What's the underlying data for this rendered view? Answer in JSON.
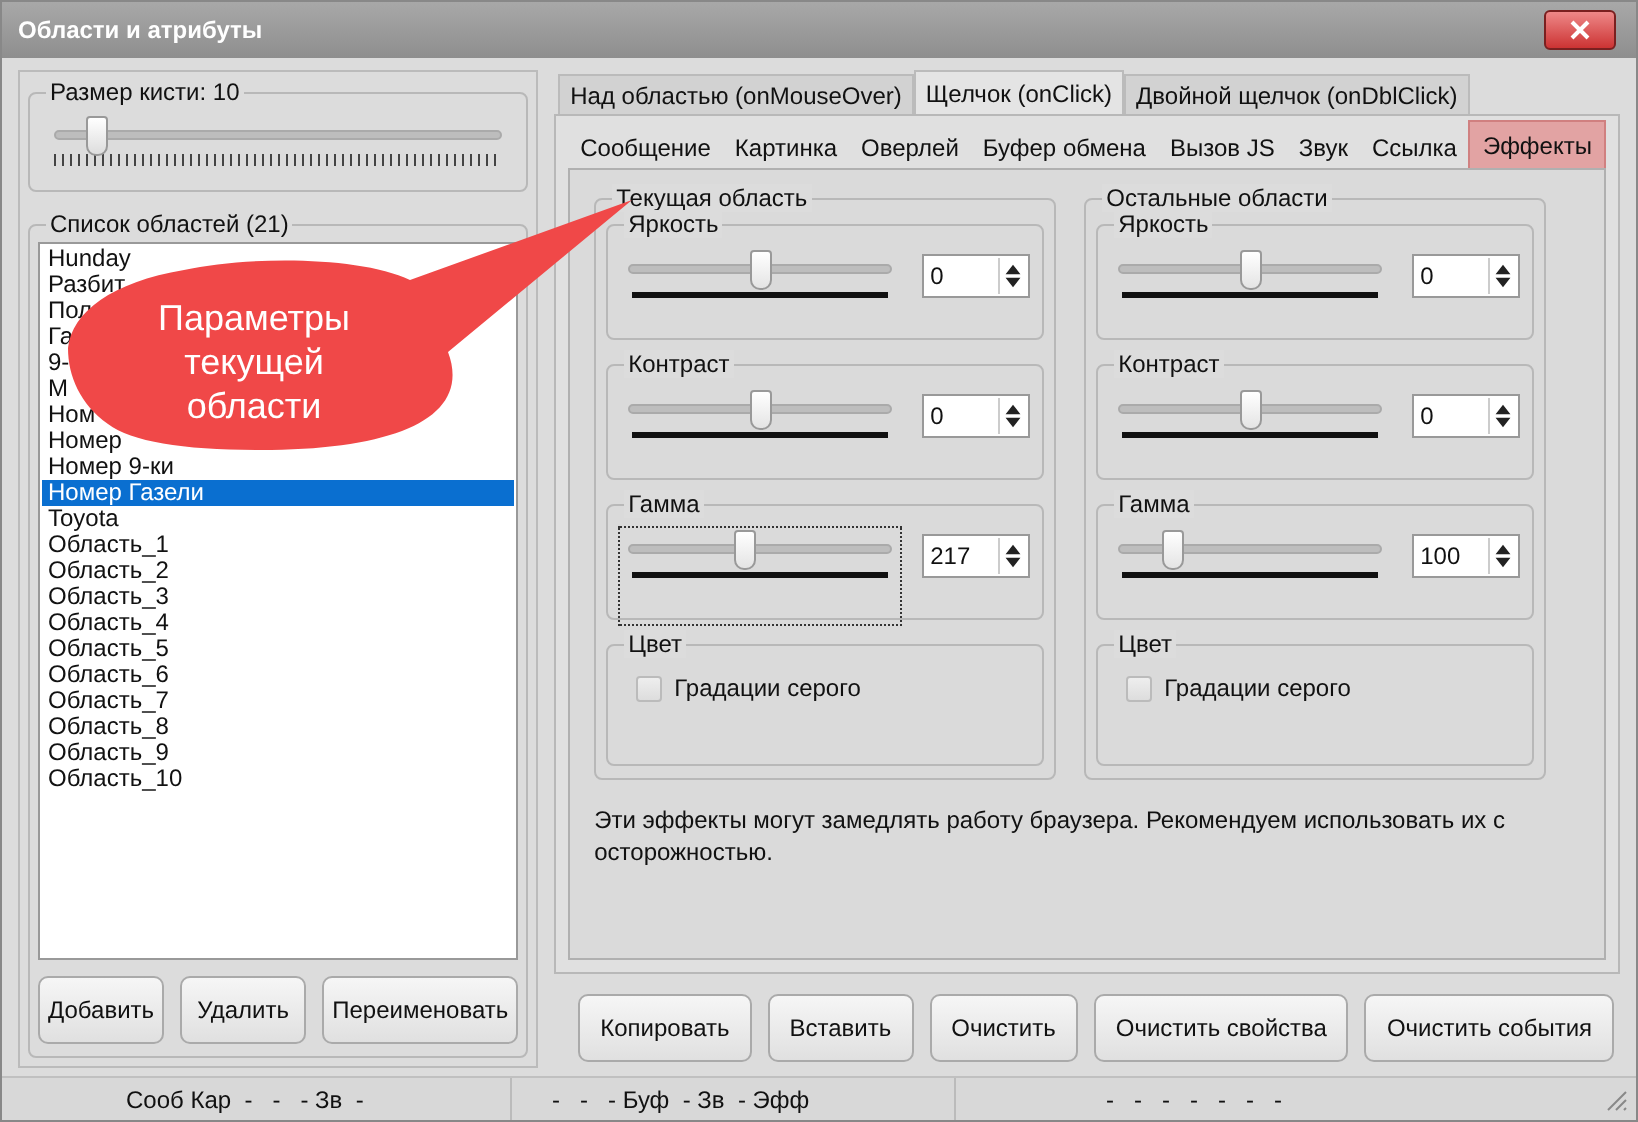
{
  "window": {
    "title": "Области и атрибуты"
  },
  "brush": {
    "label": "Размер кисти: 10",
    "level": 0.09
  },
  "areas": {
    "label": "Список областей (21)",
    "items": [
      {
        "text": "Hunday",
        "selected": false
      },
      {
        "text": "Разбит",
        "selected": false
      },
      {
        "text": "Пол",
        "selected": false
      },
      {
        "text": "Га",
        "selected": false
      },
      {
        "text": "9-",
        "selected": false
      },
      {
        "text": "М",
        "selected": false
      },
      {
        "text": "Ном",
        "selected": false
      },
      {
        "text": "Номер",
        "selected": false
      },
      {
        "text": "Номер 9-ки",
        "selected": false
      },
      {
        "text": "Номер Газели",
        "selected": true
      },
      {
        "text": "Toyota",
        "selected": false
      },
      {
        "text": "Область_1",
        "selected": false
      },
      {
        "text": "Область_2",
        "selected": false
      },
      {
        "text": "Область_3",
        "selected": false
      },
      {
        "text": "Область_4",
        "selected": false
      },
      {
        "text": "Область_5",
        "selected": false
      },
      {
        "text": "Область_6",
        "selected": false
      },
      {
        "text": "Область_7",
        "selected": false
      },
      {
        "text": "Область_8",
        "selected": false
      },
      {
        "text": "Область_9",
        "selected": false
      },
      {
        "text": "Область_10",
        "selected": false
      }
    ]
  },
  "left_buttons": [
    "Добавить",
    "Удалить",
    "Переименовать"
  ],
  "event_tabs": [
    {
      "label": "Над областью (onMouseOver)",
      "selected": false
    },
    {
      "label": "Щелчок (onClick)",
      "selected": true
    },
    {
      "label": "Двойной щелчок (onDblClick)",
      "selected": false
    }
  ],
  "action_tabs": [
    {
      "label": "Сообщение",
      "selected": false
    },
    {
      "label": "Картинка",
      "selected": false
    },
    {
      "label": "Оверлей",
      "selected": false
    },
    {
      "label": "Буфер обмена",
      "selected": false
    },
    {
      "label": "Вызов JS",
      "selected": false
    },
    {
      "label": "Звук",
      "selected": false
    },
    {
      "label": "Ссылка",
      "selected": false
    },
    {
      "label": "Эффекты",
      "selected": true
    }
  ],
  "panels": [
    {
      "title": "Текущая область",
      "sliders": [
        {
          "label": "Яркость",
          "level": 0.5,
          "value": "0",
          "focused": false
        },
        {
          "label": "Контраст",
          "level": 0.5,
          "value": "0",
          "focused": false
        },
        {
          "label": "Гамма",
          "level": 0.44,
          "value": "217",
          "focused": true
        }
      ],
      "color_group": {
        "label": "Цвет",
        "checkbox": {
          "label": "Градации серого",
          "checked": false
        }
      }
    },
    {
      "title": "Остальные области",
      "sliders": [
        {
          "label": "Яркость",
          "level": 0.5,
          "value": "0",
          "focused": false
        },
        {
          "label": "Контраст",
          "level": 0.5,
          "value": "0",
          "focused": false
        },
        {
          "label": "Гамма",
          "level": 0.2,
          "value": "100",
          "focused": false
        }
      ],
      "color_group": {
        "label": "Цвет",
        "checkbox": {
          "label": "Градации серого",
          "checked": false
        }
      }
    }
  ],
  "note": "Эти эффекты могут замедлять работу браузера. Рекомендуем использовать их с осторожностью.",
  "bottom_buttons": [
    "Копировать",
    "Вставить",
    "Очистить",
    "Очистить свойства",
    "Очистить события"
  ],
  "status_bar": [
    "Сооб Кар  -   -   - Зв  -",
    "-   -   - Буф  - Зв  - Эфф",
    "-   -   -   -   -   -   -"
  ],
  "callout": {
    "text": "Параметры текущей области"
  }
}
